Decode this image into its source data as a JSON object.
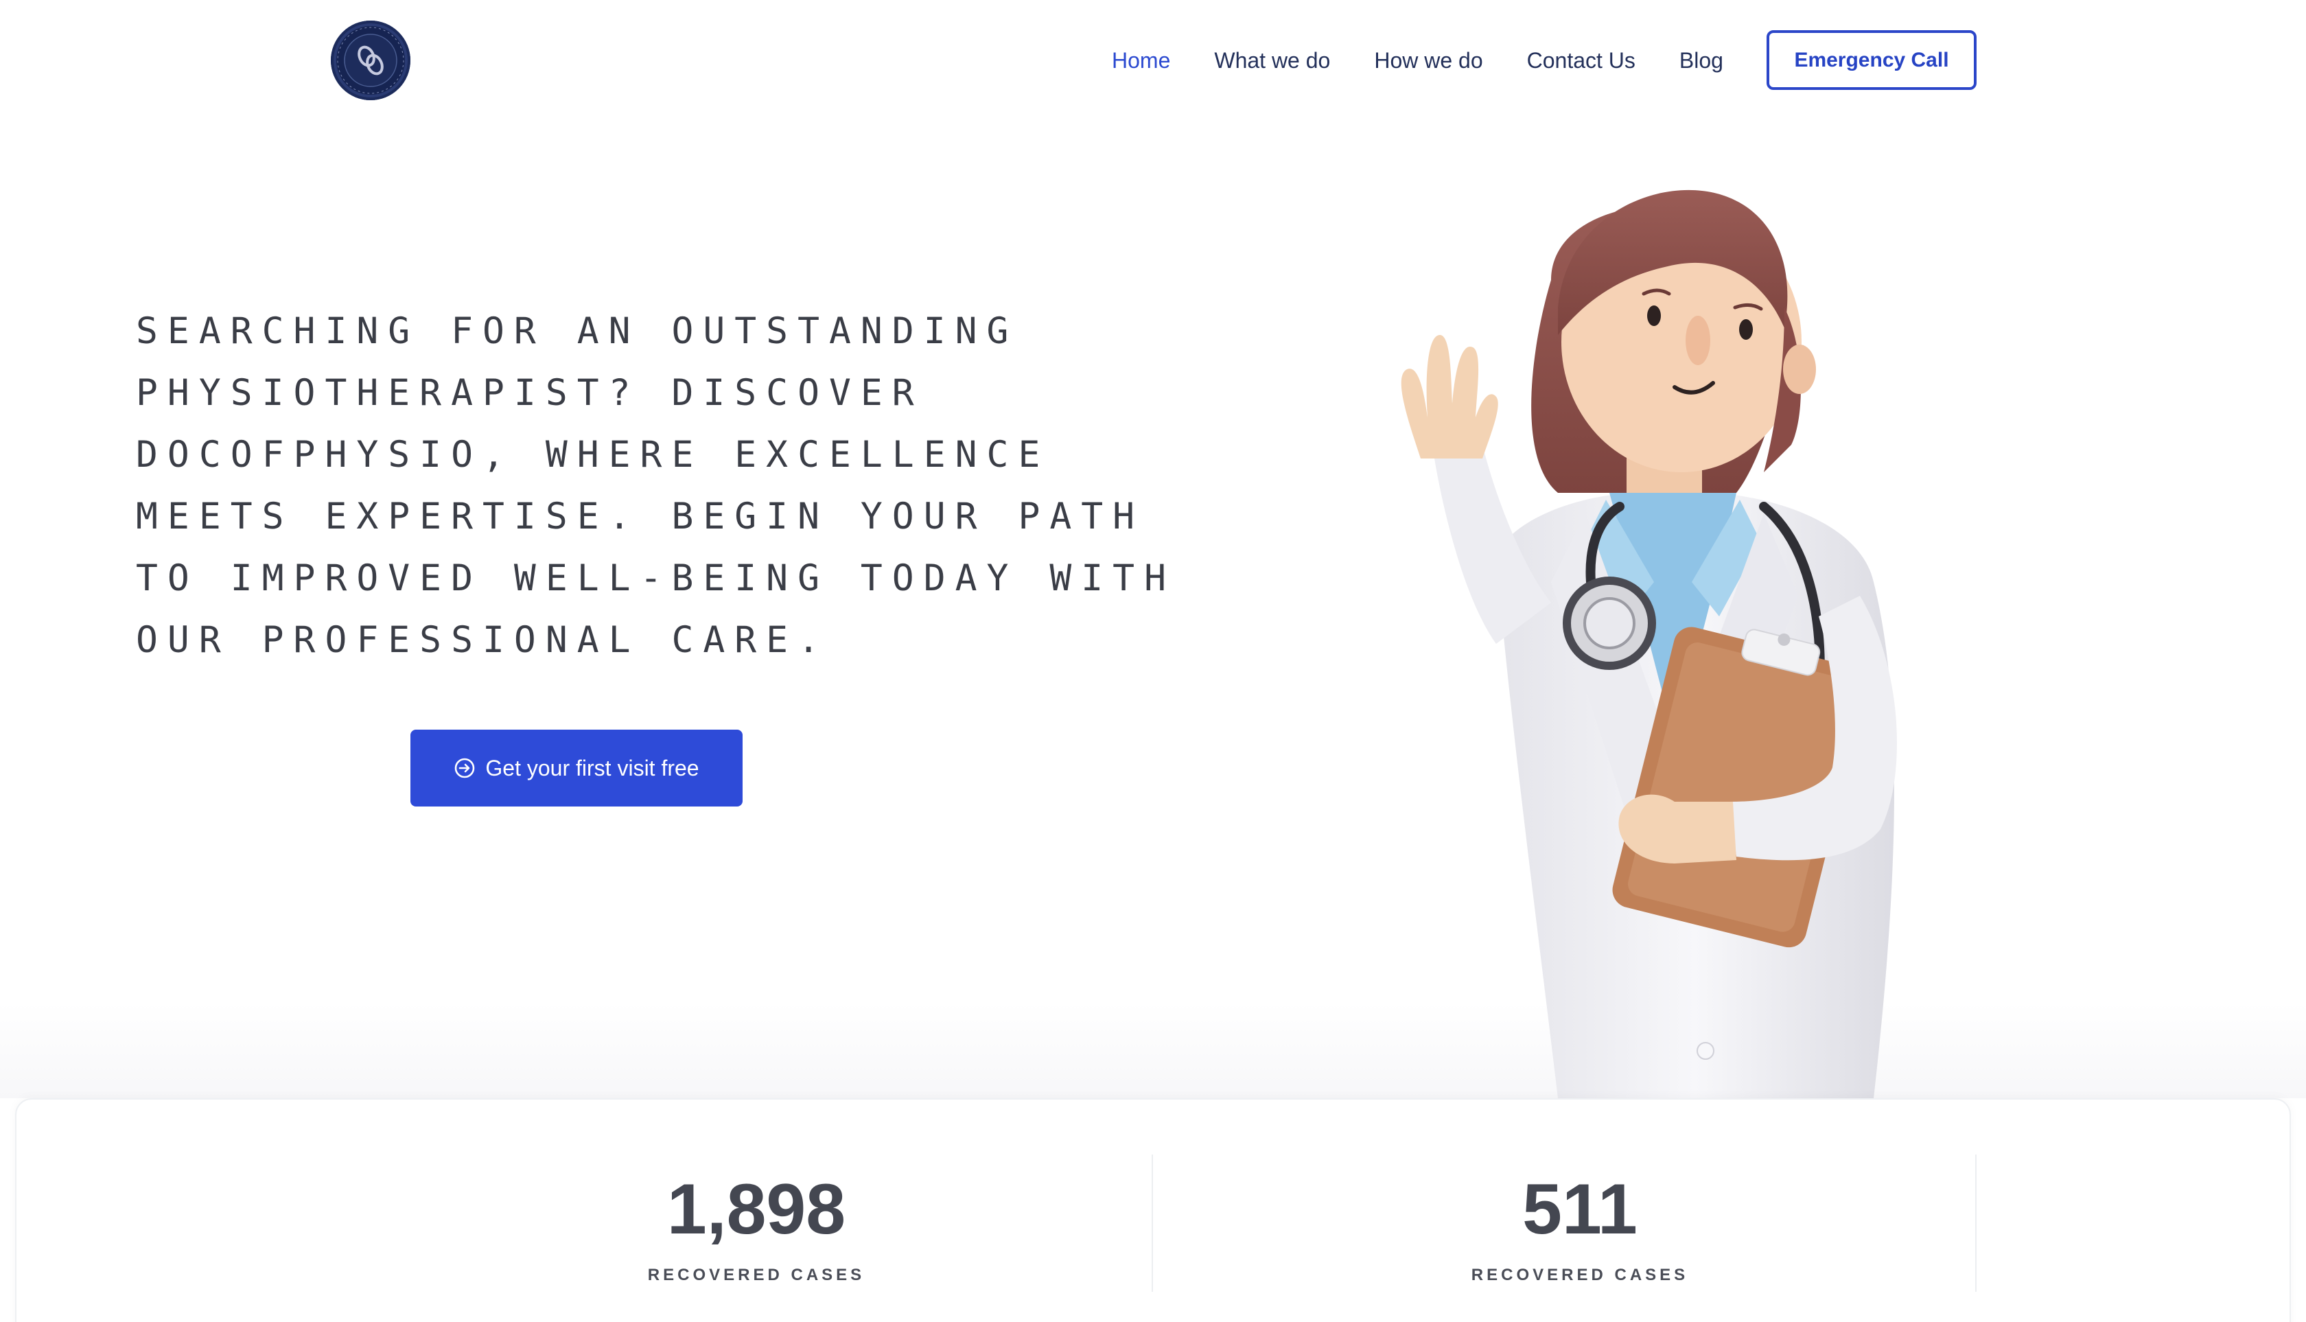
{
  "header": {
    "logo_alt": "Doc of Physio",
    "nav": [
      {
        "label": "Home",
        "active": true
      },
      {
        "label": "What we do"
      },
      {
        "label": "How we do"
      },
      {
        "label": "Contact Us"
      },
      {
        "label": "Blog"
      }
    ],
    "emergency_label": "Emergency Call"
  },
  "hero": {
    "headline": "SEARCHING FOR AN OUTSTANDING PHYSIOTHERAPIST? DISCOVER DOCOFPHYSIO, WHERE EXCELLENCE MEETS EXPERTISE. BEGIN YOUR PATH TO IMPROVED WELL-BEING TODAY WITH OUR PROFESSIONAL CARE.",
    "cta_label": "Get your first visit free",
    "cta_icon": "arrow-circle-right-icon",
    "illustration": "doctor-waving-illustration"
  },
  "stats": [
    {
      "value": "1,898",
      "label": "RECOVERED CASES"
    },
    {
      "value": "511",
      "label": "RECOVERED CASES"
    }
  ],
  "colors": {
    "accent": "#2e4bd8",
    "nav_text": "#23305a",
    "heading": "#3a3d46",
    "stat_text": "#444751"
  }
}
